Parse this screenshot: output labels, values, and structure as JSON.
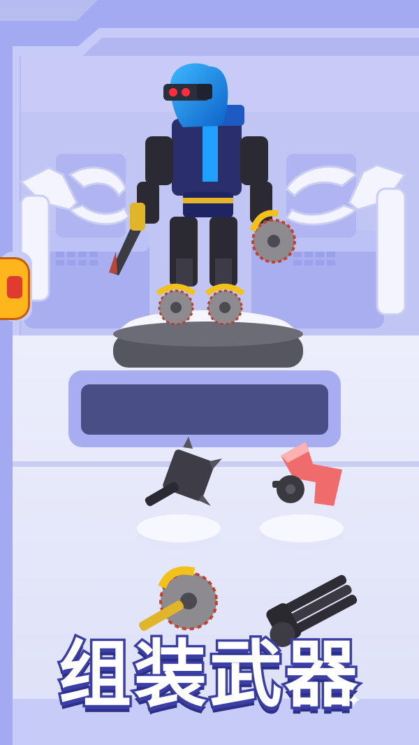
{
  "screen": {
    "title": "组装武器",
    "sparkle_icon": "sparkle-icon"
  },
  "scene": {
    "robot": "assembled-robot",
    "weapon_slots": [
      {
        "name": "spiked-hammer"
      },
      {
        "name": "red-claw"
      },
      {
        "name": "yellow-saw-blade"
      },
      {
        "name": "gatling-gun"
      }
    ]
  },
  "colors": {
    "frame": "#8f96ee",
    "frame_dark": "#5a5fcb",
    "title_stroke": "#3b3fa5",
    "screen_panel": "#4a4e86"
  }
}
